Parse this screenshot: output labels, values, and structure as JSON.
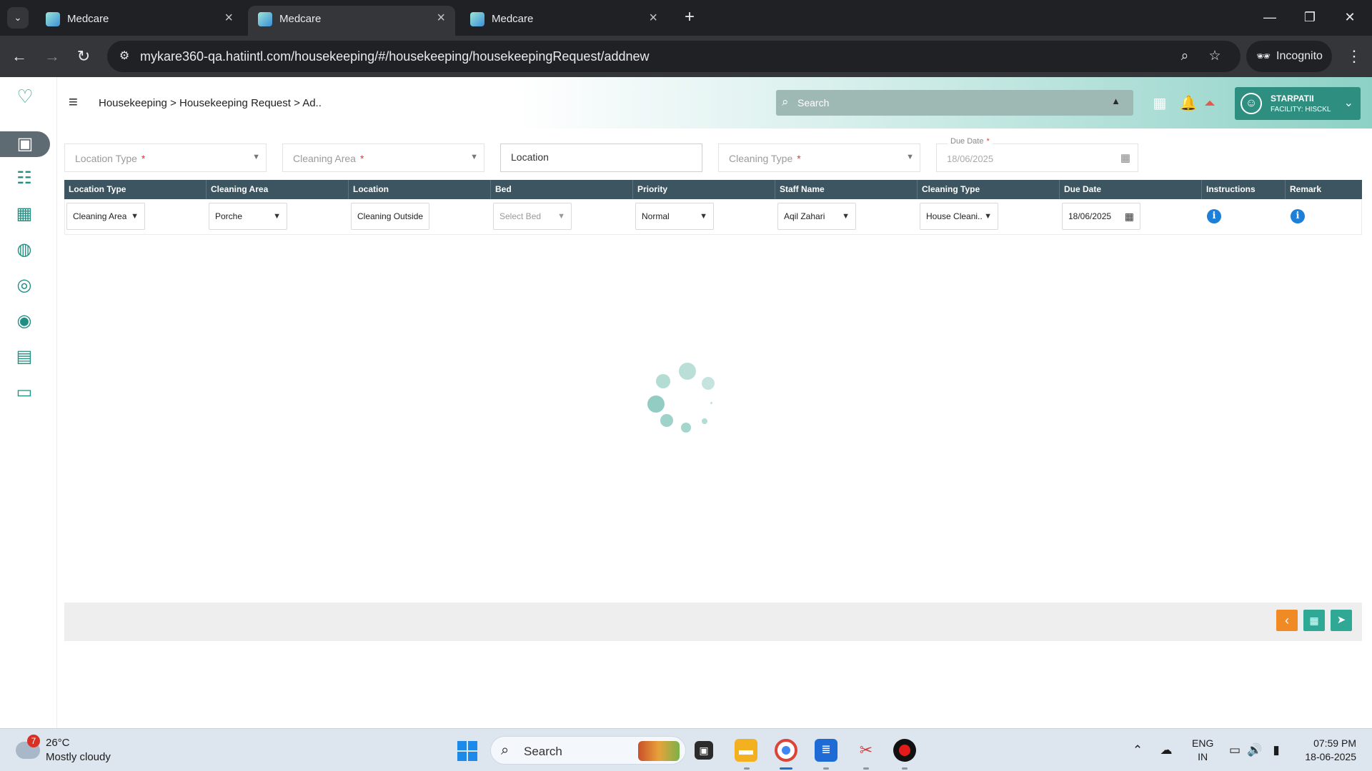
{
  "browser": {
    "tabs": [
      {
        "title": "Medcare"
      },
      {
        "title": "Medcare"
      },
      {
        "title": "Medcare"
      }
    ],
    "url": "mykare360-qa.hatiintl.com/housekeeping/#/housekeeping/housekeepingRequest/addnew",
    "incognito_label": "Incognito"
  },
  "header": {
    "breadcrumb": "Housekeeping > Housekeeping Request > Ad..",
    "search_placeholder": "Search",
    "user_name": "STARPATII",
    "facility": "FACILITY: HISCKL"
  },
  "filters": {
    "location_type": "Location Type",
    "cleaning_area": "Cleaning Area",
    "location": "Location",
    "cleaning_type": "Cleaning Type",
    "due_date_label": "Due Date",
    "due_date_value": "18/06/2025",
    "required_mark": "*"
  },
  "table": {
    "headers": [
      "Location Type",
      "Cleaning Area",
      "Location",
      "Bed",
      "Priority",
      "Staff Name",
      "Cleaning Type",
      "Due Date",
      "Instructions",
      "Remark"
    ],
    "row": {
      "location_type": "Cleaning Area",
      "cleaning_area": "Porche",
      "location": "Cleaning Outside",
      "bed": "Select Bed",
      "priority": "Normal",
      "staff_name": "Aqil Zahari",
      "cleaning_type": "House Cleani...",
      "due_date": "18/06/2025"
    }
  },
  "footer_buttons": [
    "back",
    "save-draft",
    "submit"
  ],
  "taskbar": {
    "weather_badge": "7",
    "temperature": "26°C",
    "weather": "Mostly cloudy",
    "search_placeholder": "Search",
    "lang_line1": "ENG",
    "lang_line2": "IN",
    "time": "07:59 PM",
    "date": "18-06-2025"
  },
  "colors": {
    "accent": "#2e8f81",
    "table_header": "#3d5560",
    "back_button": "#f08a24",
    "action_button": "#2fa896",
    "info_icon": "#1e7fd8"
  }
}
